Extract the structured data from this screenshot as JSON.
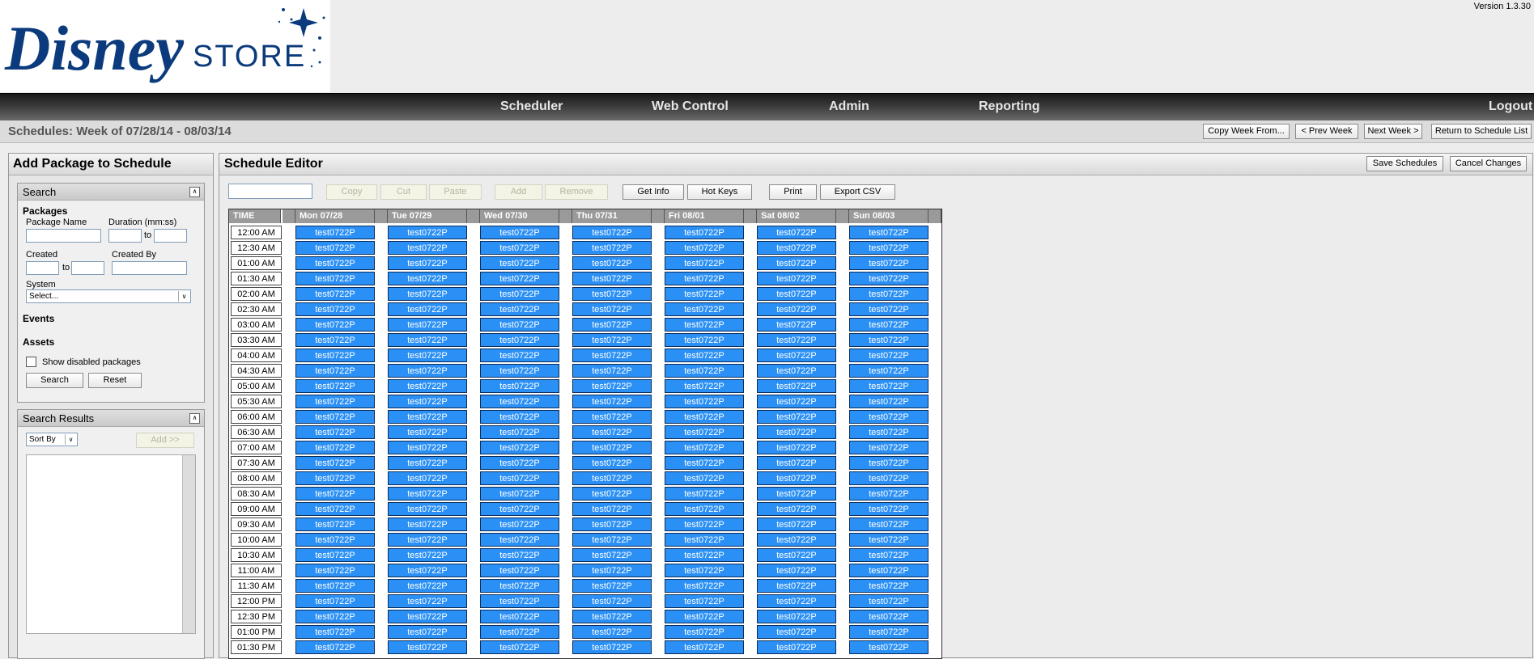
{
  "header": {
    "brand_main": "Disney",
    "brand_sub": "STORE",
    "version": "Version 1.3.30"
  },
  "nav": {
    "items": [
      "Scheduler",
      "Web Control",
      "Admin",
      "Reporting"
    ],
    "logout": "Logout"
  },
  "titlebar": {
    "title": "Schedules: Week of 07/28/14 - 08/03/14",
    "buttons": [
      "Copy Week From...",
      "< Prev Week",
      "Next Week >",
      "Return to Schedule List"
    ]
  },
  "left_panel": {
    "title": "Add Package to Schedule",
    "search": {
      "title": "Search",
      "packages_heading": "Packages",
      "package_name_label": "Package Name",
      "duration_label": "Duration (mm:ss)",
      "to_label": "to",
      "created_label": "Created",
      "created_by_label": "Created By",
      "system_label": "System",
      "system_value": "Select...",
      "events_heading": "Events",
      "assets_heading": "Assets",
      "show_disabled_label": "Show disabled packages",
      "search_button": "Search",
      "reset_button": "Reset"
    },
    "results": {
      "title": "Search Results",
      "sort_by": "Sort By",
      "add_button": "Add >>"
    }
  },
  "editor": {
    "title": "Schedule Editor",
    "save_button": "Save Schedules",
    "cancel_button": "Cancel Changes",
    "toolbar": {
      "copy": "Copy",
      "cut": "Cut",
      "paste": "Paste",
      "add": "Add",
      "remove": "Remove",
      "get_info": "Get Info",
      "hot_keys": "Hot Keys",
      "print": "Print",
      "export_csv": "Export CSV"
    },
    "time_header": "TIME",
    "days": [
      "Mon 07/28",
      "Tue 07/29",
      "Wed 07/30",
      "Thu 07/31",
      "Fri 08/01",
      "Sat 08/02",
      "Sun 08/03"
    ],
    "times": [
      "12:00 AM",
      "12:30 AM",
      "01:00 AM",
      "01:30 AM",
      "02:00 AM",
      "02:30 AM",
      "03:00 AM",
      "03:30 AM",
      "04:00 AM",
      "04:30 AM",
      "05:00 AM",
      "05:30 AM",
      "06:00 AM",
      "06:30 AM",
      "07:00 AM",
      "07:30 AM",
      "08:00 AM",
      "08:30 AM",
      "09:00 AM",
      "09:30 AM",
      "10:00 AM",
      "10:30 AM",
      "11:00 AM",
      "11:30 AM",
      "12:00 PM",
      "12:30 PM",
      "01:00 PM",
      "01:30 PM"
    ],
    "cell_label": "test0722P",
    "cell_color": "#2b90f5"
  }
}
